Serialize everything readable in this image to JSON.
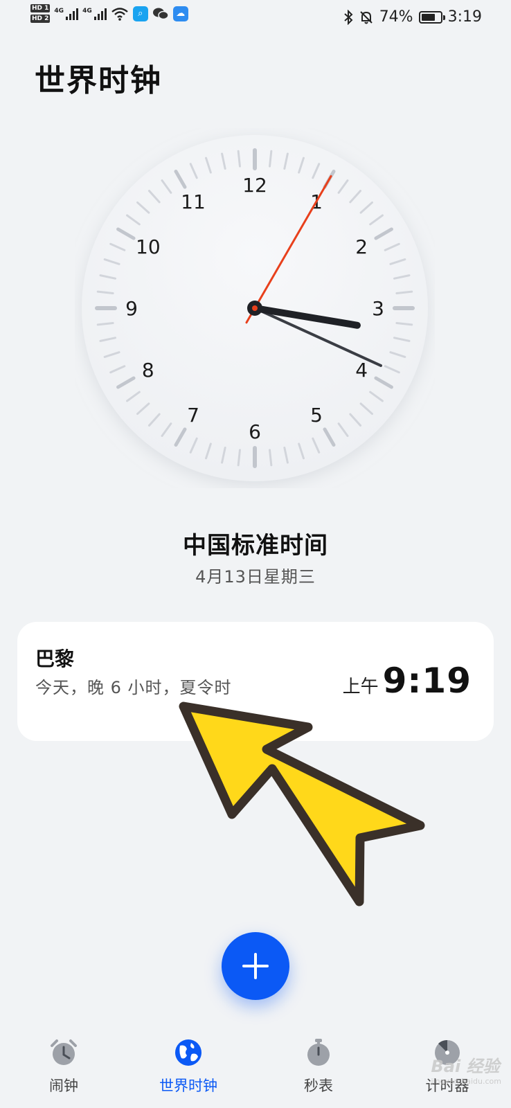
{
  "status_bar": {
    "sim1": "HD 1",
    "sim2": "HD 2",
    "network1": "4G",
    "network2": "4G",
    "battery_text": "74%",
    "battery_level": 0.74,
    "time": "3:19",
    "icons": [
      "signal-icon",
      "wifi-icon",
      "search-app-icon",
      "wechat-icon",
      "cloud-icon",
      "bluetooth-icon",
      "mute-icon",
      "battery-icon"
    ]
  },
  "page": {
    "title": "世界时钟"
  },
  "clock": {
    "numbers": [
      "12",
      "1",
      "2",
      "3",
      "4",
      "5",
      "6",
      "7",
      "8",
      "9",
      "10",
      "11"
    ],
    "hour": 3,
    "minute": 19,
    "second": 5,
    "second_hand_color": "#e8401c"
  },
  "home": {
    "zone": "中国标准时间",
    "date": "4月13日星期三"
  },
  "cities": [
    {
      "name": "巴黎",
      "diff": "今天，晚 6 小时，夏令时",
      "ampm": "上午",
      "time": "9:19"
    }
  ],
  "fab": {
    "icon": "plus-icon",
    "color": "#0b59f5"
  },
  "tabs": [
    {
      "label": "闹钟",
      "icon": "alarm-clock-icon",
      "active": false
    },
    {
      "label": "世界时钟",
      "icon": "globe-icon",
      "active": true
    },
    {
      "label": "秒表",
      "icon": "stopwatch-icon",
      "active": false
    },
    {
      "label": "计时器",
      "icon": "timer-icon",
      "active": false
    }
  ],
  "watermark": {
    "text": "Bai 经验",
    "sub": "jingyan.baidu.com"
  },
  "colors": {
    "accent": "#0b59f5",
    "arrow_fill": "#ffd81a",
    "arrow_stroke": "#3a3029"
  }
}
